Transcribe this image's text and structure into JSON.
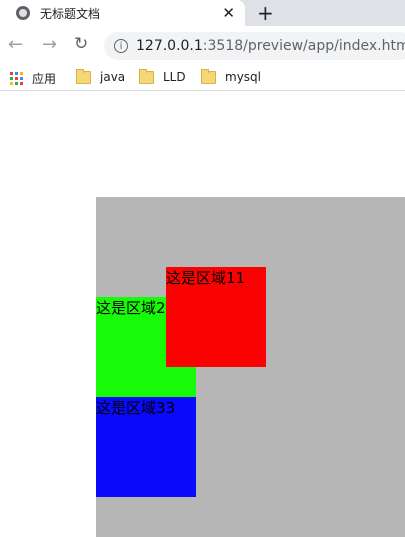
{
  "browser": {
    "tab": {
      "title": "无标题文档",
      "close_symbol": "✕"
    },
    "new_tab_symbol": "+",
    "toolbar": {
      "back_symbol": "←",
      "forward_symbol": "→",
      "reload_symbol": "↻",
      "info_symbol": "i",
      "url_host": "127.0.0.1",
      "url_rest": ":3518/preview/app/index.html"
    },
    "bookmarks": {
      "apps_label": "应用",
      "items": [
        {
          "label": "java"
        },
        {
          "label": "LLD"
        },
        {
          "label": "mysql"
        }
      ]
    }
  },
  "page": {
    "colors": {
      "background_area": "#b6b6b6",
      "region1": "#fb0202",
      "region2": "#17fb08",
      "region3": "#0a0afb"
    },
    "regions": {
      "region1_label": "这是区域11",
      "region2_label": "这是区域22",
      "region3_label": "这是区域33"
    }
  }
}
